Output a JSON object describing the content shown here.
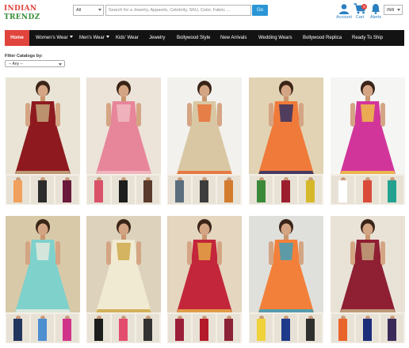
{
  "header": {
    "logo_line1": "INDIAN",
    "logo_line2": "TRENDZ",
    "category_select": "All",
    "search_placeholder": "Search for a Jewelry, Apparels, Celebrity, SKU, Color, Fabric ...",
    "go_label": "Go",
    "account_label": "Account",
    "cart_label": "Cart",
    "cart_count": "0",
    "alerts_label": "Alerts",
    "currency": "INR"
  },
  "nav": {
    "items": [
      {
        "label": "Home",
        "dropdown": false
      },
      {
        "label": "Women's Wear",
        "dropdown": true
      },
      {
        "label": "Men's Wear",
        "dropdown": true
      },
      {
        "label": "Kids' Wear",
        "dropdown": false
      },
      {
        "label": "Jewelry",
        "dropdown": false
      },
      {
        "label": "Bollywood Style",
        "dropdown": false
      },
      {
        "label": "New Arrivals",
        "dropdown": false
      },
      {
        "label": "Wedding Wears",
        "dropdown": false
      },
      {
        "label": "Bollywood Replica",
        "dropdown": false
      },
      {
        "label": "Ready To Ship",
        "dropdown": false
      }
    ]
  },
  "filter": {
    "label": "Filter Catalogs by:",
    "value": "-- Any --"
  },
  "colors": {
    "brand_red": "#e0443c",
    "brand_green": "#3a8d3a",
    "nav_bg": "#131313",
    "accent_blue": "#2a96d6"
  },
  "icons": {
    "account": "user-icon",
    "cart": "shopping-cart-icon",
    "alerts": "bell-icon"
  },
  "products": [
    {
      "bg": "#e9e4d6",
      "garment": "#8e1a1f",
      "accent": "#c9b98a",
      "thumbs": [
        "#f0a05c",
        "#2c2c2c",
        "#6b1a3c"
      ]
    },
    {
      "bg": "#ece3d9",
      "garment": "#e7859a",
      "accent": "#f2c2c8",
      "thumbs": [
        "#d9526a",
        "#1d1d1d",
        "#5a3a2c"
      ]
    },
    {
      "bg": "#f3f1ee",
      "garment": "#d9c7a3",
      "accent": "#e9652a",
      "thumbs": [
        "#5a6e7d",
        "#3d3d3d",
        "#d37c2e"
      ]
    },
    {
      "bg": "#e2d3b4",
      "garment": "#f07a3a",
      "accent": "#1b2a6a",
      "thumbs": [
        "#3b8a3a",
        "#9b1d2e",
        "#d6b92a"
      ]
    },
    {
      "bg": "#f5f5f3",
      "garment": "#d2359a",
      "accent": "#f2d33a",
      "thumbs": [
        "#ffffff",
        "#d94a3a",
        "#23a38f"
      ]
    },
    {
      "bg": "#d8c9a8",
      "garment": "#7fd1cc",
      "accent": "#f0ece0",
      "thumbs": [
        "#23365e",
        "#4c8fd1",
        "#d0348a"
      ]
    },
    {
      "bg": "#ddd2bb",
      "garment": "#f1ead3",
      "accent": "#c9a23a",
      "thumbs": [
        "#1c1c1c",
        "#e44c6e",
        "#333333"
      ]
    },
    {
      "bg": "#e4d6bf",
      "garment": "#c3263a",
      "accent": "#e8b94a",
      "thumbs": [
        "#9c1f3a",
        "#b51a2b",
        "#8b2235"
      ]
    },
    {
      "bg": "#dfe0dc",
      "garment": "#f3803a",
      "accent": "#2aa3c9",
      "thumbs": [
        "#f0d23a",
        "#1e3a8a",
        "#2f2f2f"
      ]
    },
    {
      "bg": "#e9e3d7",
      "garment": "#8f1f33",
      "accent": "#c9b88a",
      "thumbs": [
        "#e9642a",
        "#1c2c7a",
        "#3a2a5a"
      ]
    }
  ]
}
